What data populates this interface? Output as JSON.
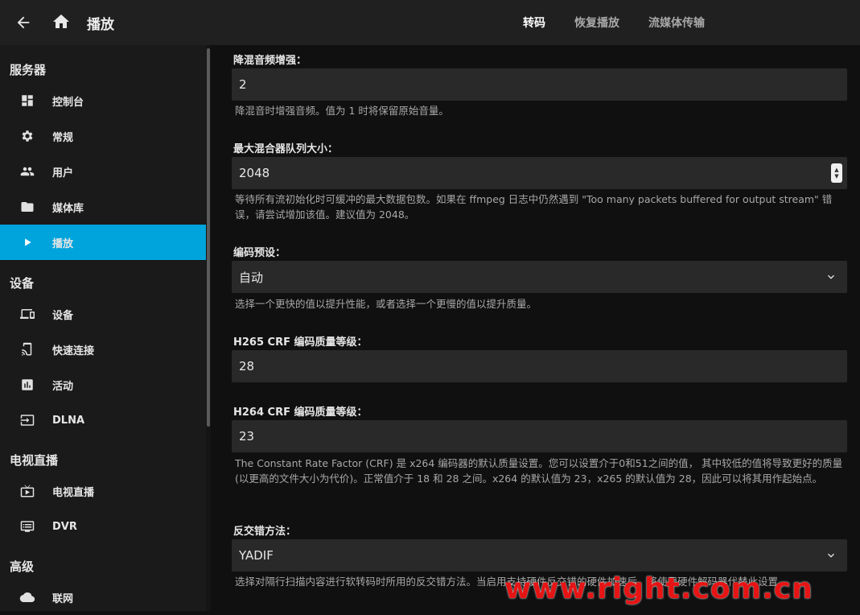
{
  "header": {
    "title": "播放",
    "tabs": [
      {
        "label": "转码",
        "active": true
      },
      {
        "label": "恢复播放",
        "active": false
      },
      {
        "label": "流媒体传输",
        "active": false
      }
    ]
  },
  "sidebar": {
    "sections": [
      {
        "title": "服务器"
      },
      {
        "title": "设备"
      },
      {
        "title": "电视直播"
      },
      {
        "title": "高级"
      }
    ],
    "items": [
      {
        "label": "控制台",
        "icon": "dashboard-icon"
      },
      {
        "label": "常规",
        "icon": "gear-icon"
      },
      {
        "label": "用户",
        "icon": "users-icon"
      },
      {
        "label": "媒体库",
        "icon": "folder-icon"
      },
      {
        "label": "播放",
        "icon": "play-icon",
        "active": true
      },
      {
        "label": "设备",
        "icon": "devices-icon"
      },
      {
        "label": "快速连接",
        "icon": "cast-icon"
      },
      {
        "label": "活动",
        "icon": "activity-icon"
      },
      {
        "label": "DLNA",
        "icon": "input-icon"
      },
      {
        "label": "电视直播",
        "icon": "tv-icon"
      },
      {
        "label": "DVR",
        "icon": "dvr-icon"
      },
      {
        "label": "联网",
        "icon": "cloud-icon"
      }
    ],
    "active_color": "#00a4dc"
  },
  "main": {
    "downmix": {
      "label": "降混音频增强：",
      "value": "2",
      "help": "降混音时增强音频。值为 1 时将保留原始音量。"
    },
    "muxer_queue": {
      "label": "最大混合器队列大小：",
      "value": "2048",
      "help": "等待所有流初始化时可缓冲的最大数据包数。如果在 ffmpeg 日志中仍然遇到 \"Too many packets buffered for output stream\" 错误，请尝试增加该值。建议值为 2048。"
    },
    "encoding_preset": {
      "label": "编码预设：",
      "value": "自动",
      "help": "选择一个更快的值以提升性能，或者选择一个更慢的值以提升质量。"
    },
    "h265_crf": {
      "label": "H265 CRF 编码质量等级：",
      "value": "28"
    },
    "h264_crf": {
      "label": "H264 CRF 编码质量等级：",
      "value": "23",
      "help": "The Constant Rate Factor (CRF) 是 x264 编码器的默认质量设置。您可以设置介于0和51之间的值， 其中较低的值将导致更好的质量 (以更高的文件大小为代价)。正常值介于 18 和 28 之间。x264 的默认值为 23，x265 的默认值为 28，因此可以将其用作起始点。"
    },
    "deinterlace": {
      "label": "反交错方法：",
      "value": "YADIF",
      "help": "选择对隔行扫描内容进行软转码时所用的反交错方法。当启用支持硬件反交错的硬件加速后，将使用硬件解码器代替此设置。"
    }
  },
  "watermark": "www.right.com.cn"
}
